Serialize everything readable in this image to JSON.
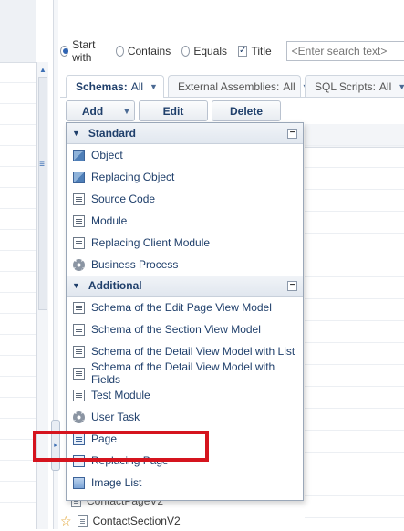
{
  "search": {
    "options": [
      {
        "label": "Start with",
        "selected": true
      },
      {
        "label": "Contains",
        "selected": false
      },
      {
        "label": "Equals",
        "selected": false
      }
    ],
    "title_checkbox": {
      "label": "Title",
      "checked": true
    },
    "placeholder": "<Enter search text>"
  },
  "tabs": [
    {
      "label": "Schemas:",
      "filter": "All",
      "active": true
    },
    {
      "label": "External Assemblies:",
      "filter": "All",
      "active": false
    },
    {
      "label": "SQL Scripts:",
      "filter": "All",
      "active": false
    }
  ],
  "toolbar": {
    "add_label": "Add",
    "edit_label": "Edit",
    "delete_label": "Delete"
  },
  "menu": {
    "groups": [
      {
        "title": "Standard",
        "items": [
          {
            "label": "Object",
            "icon": "object-icon"
          },
          {
            "label": "Replacing Object",
            "icon": "object-icon"
          },
          {
            "label": "Source Code",
            "icon": "document-icon"
          },
          {
            "label": "Module",
            "icon": "document-icon"
          },
          {
            "label": "Replacing Client Module",
            "icon": "document-icon"
          },
          {
            "label": "Business Process",
            "icon": "gear-icon"
          }
        ]
      },
      {
        "title": "Additional",
        "items": [
          {
            "label": "Schema of the Edit Page View Model",
            "icon": "document-icon"
          },
          {
            "label": "Schema of the Section View Model",
            "icon": "document-icon"
          },
          {
            "label": "Schema of the Detail View Model with List",
            "icon": "document-icon"
          },
          {
            "label": "Schema of the Detail View Model with Fields",
            "icon": "document-icon"
          },
          {
            "label": "Test Module",
            "icon": "document-icon"
          },
          {
            "label": "User Task",
            "icon": "gear-icon"
          },
          {
            "label": "Page",
            "icon": "page-icon"
          },
          {
            "label": "Replacing Page",
            "icon": "page-icon"
          },
          {
            "label": "Image List",
            "icon": "image-icon"
          }
        ]
      }
    ]
  },
  "background_rows": {
    "partial": "ContactPageV2",
    "last": "ContactSectionV2"
  },
  "colors": {
    "highlight": "#d5141e",
    "accent": "#1f3f6b"
  }
}
